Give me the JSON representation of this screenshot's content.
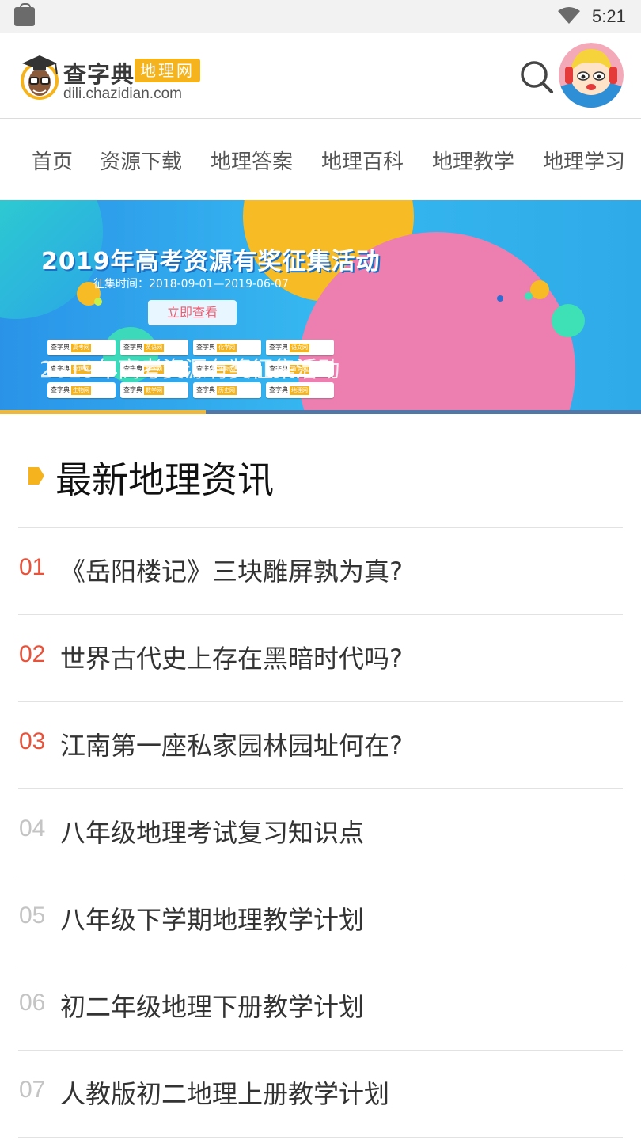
{
  "status_bar": {
    "time": "5:21"
  },
  "header": {
    "brand_name": "查字典",
    "brand_badge": "地理网",
    "brand_domain": "dili.chazidian.com"
  },
  "nav": {
    "items": [
      "首页",
      "资源下载",
      "地理答案",
      "地理百科",
      "地理教学",
      "地理学习"
    ]
  },
  "banner": {
    "title": "2019年高考资源有奖征集活动",
    "date_range": "征集时间：2018-09-01—2019-06-07",
    "button_label": "立即查看",
    "caption": "2019年高考资源有奖征集活动",
    "logos": [
      {
        "name": "查字典",
        "tag": "高考网"
      },
      {
        "name": "查字典",
        "tag": "英语网"
      },
      {
        "name": "查字典",
        "tag": "化学网"
      },
      {
        "name": "查字典",
        "tag": "语文网"
      },
      {
        "name": "查字典",
        "tag": "物理网"
      },
      {
        "name": "查字典",
        "tag": "数学网"
      },
      {
        "name": "查字典",
        "tag": "生物网"
      },
      {
        "name": "查字典",
        "tag": "政治网"
      },
      {
        "name": "查字典",
        "tag": "生物网"
      },
      {
        "name": "查字典",
        "tag": "数学网"
      },
      {
        "name": "查字典",
        "tag": "历史网"
      },
      {
        "name": "查字典",
        "tag": "地理网"
      }
    ]
  },
  "section": {
    "title": "最新地理资讯"
  },
  "news": [
    {
      "num": "01",
      "title": "《岳阳楼记》三块雕屏孰为真?"
    },
    {
      "num": "02",
      "title": "世界古代史上存在黑暗时代吗?"
    },
    {
      "num": "03",
      "title": "江南第一座私家园林园址何在?"
    },
    {
      "num": "04",
      "title": "八年级地理考试复习知识点"
    },
    {
      "num": "05",
      "title": "八年级下学期地理教学计划"
    },
    {
      "num": "06",
      "title": "初二年级地理下册教学计划"
    },
    {
      "num": "07",
      "title": "人教版初二地理上册教学计划"
    }
  ],
  "colors": {
    "accent": "#f5b41d",
    "hot_number": "#e8523a",
    "cold_number": "#c4c4c4"
  }
}
